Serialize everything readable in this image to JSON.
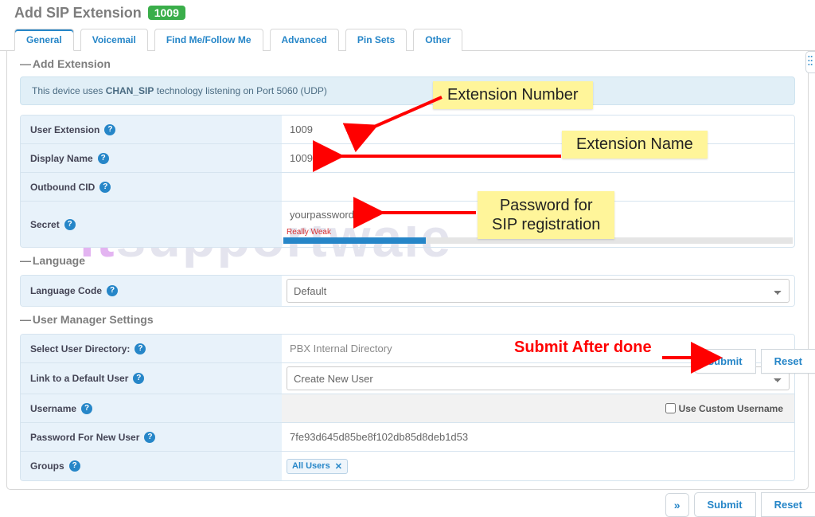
{
  "page": {
    "title": "Add SIP Extension",
    "badge": "1009"
  },
  "tabs": [
    {
      "label": "General",
      "active": true
    },
    {
      "label": "Voicemail"
    },
    {
      "label": "Find Me/Follow Me"
    },
    {
      "label": "Advanced"
    },
    {
      "label": "Pin Sets"
    },
    {
      "label": "Other"
    }
  ],
  "sections": {
    "addExtension": {
      "title": "Add Extension",
      "banner_prefix": "This device uses ",
      "banner_bold": "CHAN_SIP",
      "banner_suffix": " technology listening on Port 5060 (UDP)",
      "rows": {
        "userExtension": {
          "label": "User Extension",
          "value": "1009"
        },
        "displayName": {
          "label": "Display Name",
          "value": "1009"
        },
        "outboundCID": {
          "label": "Outbound CID",
          "value": ""
        },
        "secret": {
          "label": "Secret",
          "value": "yourpasswordhere",
          "strength_label": "Really Weak",
          "strength_pct": 28
        }
      }
    },
    "language": {
      "title": "Language",
      "rows": {
        "languageCode": {
          "label": "Language Code",
          "value": "Default"
        }
      }
    },
    "userManager": {
      "title": "User Manager Settings",
      "rows": {
        "directory": {
          "label": "Select User Directory:",
          "value": "PBX Internal Directory"
        },
        "link": {
          "label": "Link to a Default User",
          "value": "Create New User"
        },
        "username": {
          "label": "Username",
          "value": "",
          "aux": "Use Custom Username"
        },
        "password": {
          "label": "Password For New User",
          "value": "7fe93d645d85be8f102db85d8deb1d53"
        },
        "groups": {
          "label": "Groups",
          "chip": "All Users"
        }
      }
    }
  },
  "buttons": {
    "submit": "Submit",
    "reset": "Reset",
    "collapse": "»"
  },
  "annotations": {
    "extNumber": "Extension Number",
    "extName": "Extension Name",
    "sipPass1": "Password for",
    "sipPass2": "SIP registration",
    "submitAfter": "Submit After done"
  },
  "watermark": "itsupportwale"
}
